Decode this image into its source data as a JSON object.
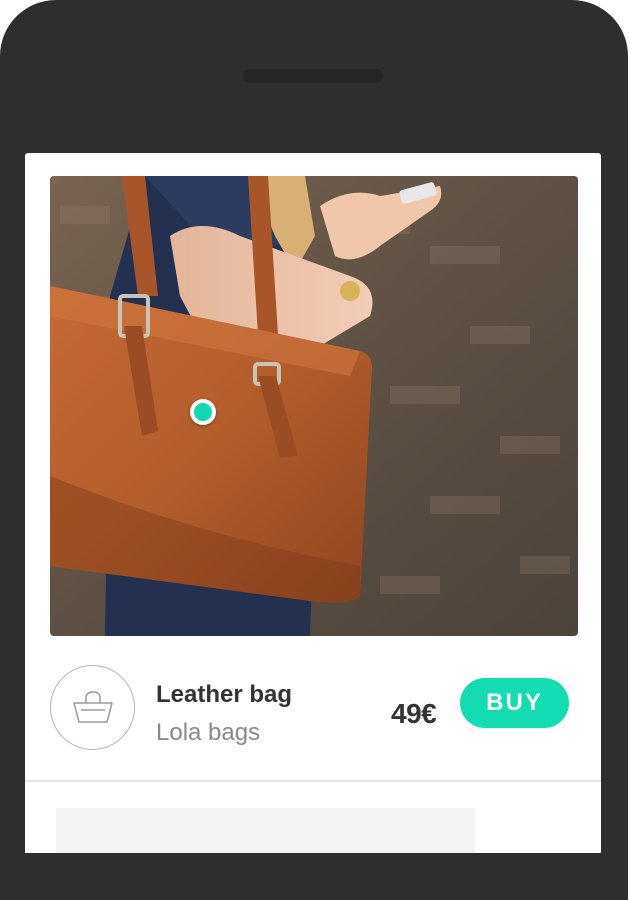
{
  "product": {
    "name": "Leather bag",
    "brand": "Lola bags",
    "price": "49€",
    "buy_label": "BUY"
  },
  "photo": {
    "hotspot_icon": "hotspot-dot-icon"
  },
  "icons": {
    "shop": "shopping-basket-icon"
  },
  "colors": {
    "accent": "#13dcb3",
    "phone_frame": "#2e2e2e",
    "text_primary": "#333333",
    "text_secondary": "#8a8a8a"
  }
}
